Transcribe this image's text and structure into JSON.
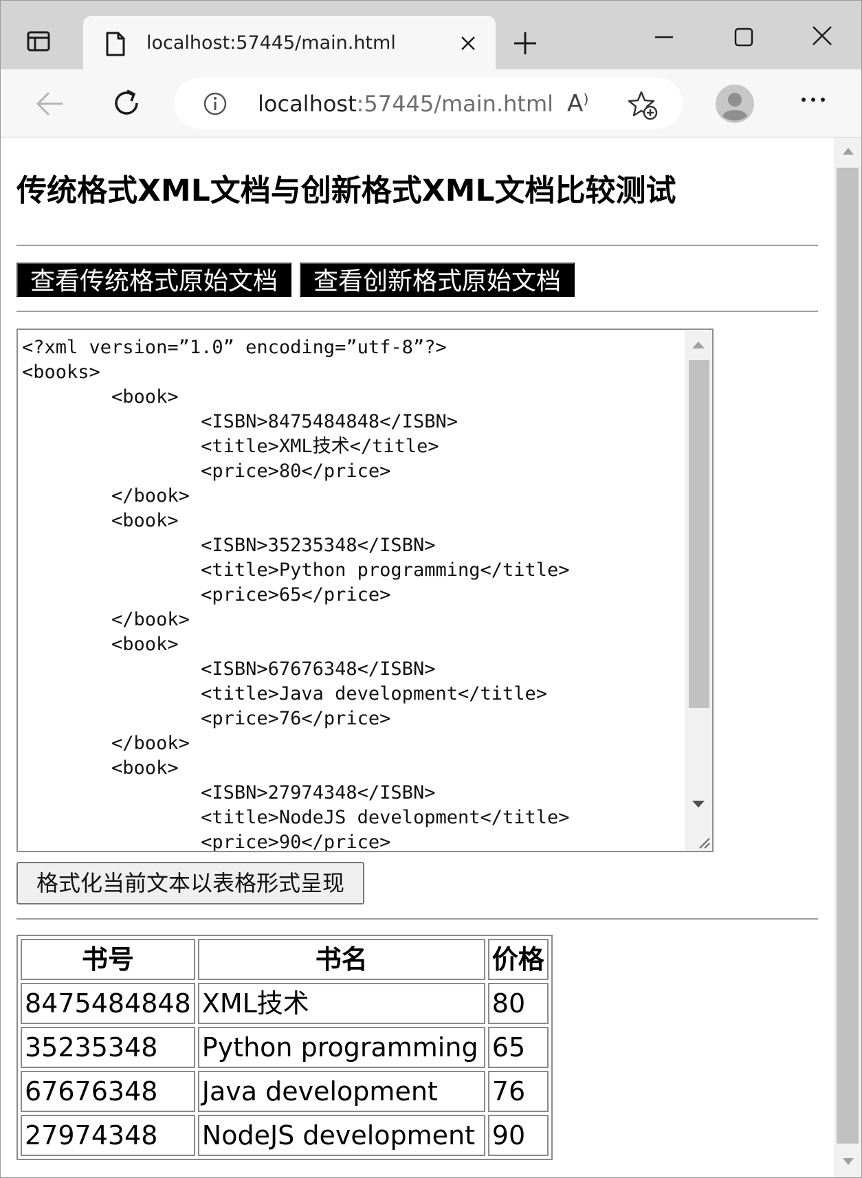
{
  "browser": {
    "tab_title": "localhost:57445/main.html",
    "url_host": "localhost",
    "url_rest": ":57445/main.html",
    "read_aloud_label": "A⁾"
  },
  "page": {
    "title": "传统格式XML文档与创新格式XML文档比较测试",
    "buttons": {
      "view_traditional": "查看传统格式原始文档",
      "view_innovative": "查看创新格式原始文档",
      "format_table": "格式化当前文本以表格形式呈现"
    },
    "xml_text": "<?xml version=”1.0” encoding=”utf-8”?>\n<books>\n        <book>\n                <ISBN>8475484848</ISBN>\n                <title>XML技术</title>\n                <price>80</price>\n        </book>\n        <book>\n                <ISBN>35235348</ISBN>\n                <title>Python programming</title>\n                <price>65</price>\n        </book>\n        <book>\n                <ISBN>67676348</ISBN>\n                <title>Java development</title>\n                <price>76</price>\n        </book>\n        <book>\n                <ISBN>27974348</ISBN>\n                <title>NodeJS development</title>\n                <price>90</price>",
    "table": {
      "headers": [
        "书号",
        "书名",
        "价格"
      ],
      "rows": [
        [
          "8475484848",
          "XML技术",
          "80"
        ],
        [
          "35235348",
          "Python programming",
          "65"
        ],
        [
          "67676348",
          "Java development",
          "76"
        ],
        [
          "27974348",
          "NodeJS development",
          "90"
        ]
      ]
    }
  },
  "icons": {
    "tab_actions": "tab-actions-icon",
    "file": "file-icon",
    "close": "close-icon",
    "new_tab": "plus-icon",
    "minimize": "minimize-icon",
    "maximize": "maximize-icon",
    "window_close": "close-icon",
    "back": "arrow-left-icon",
    "reload": "reload-icon",
    "info": "info-icon",
    "favorite": "star-plus-icon",
    "profile": "avatar",
    "more": "more-icon"
  },
  "colors": {
    "tab_strip": "#d4d4d4",
    "toolbar": "#f7f7f7",
    "dark_button": "#000000",
    "scroll_thumb": "#c1c1c1"
  }
}
